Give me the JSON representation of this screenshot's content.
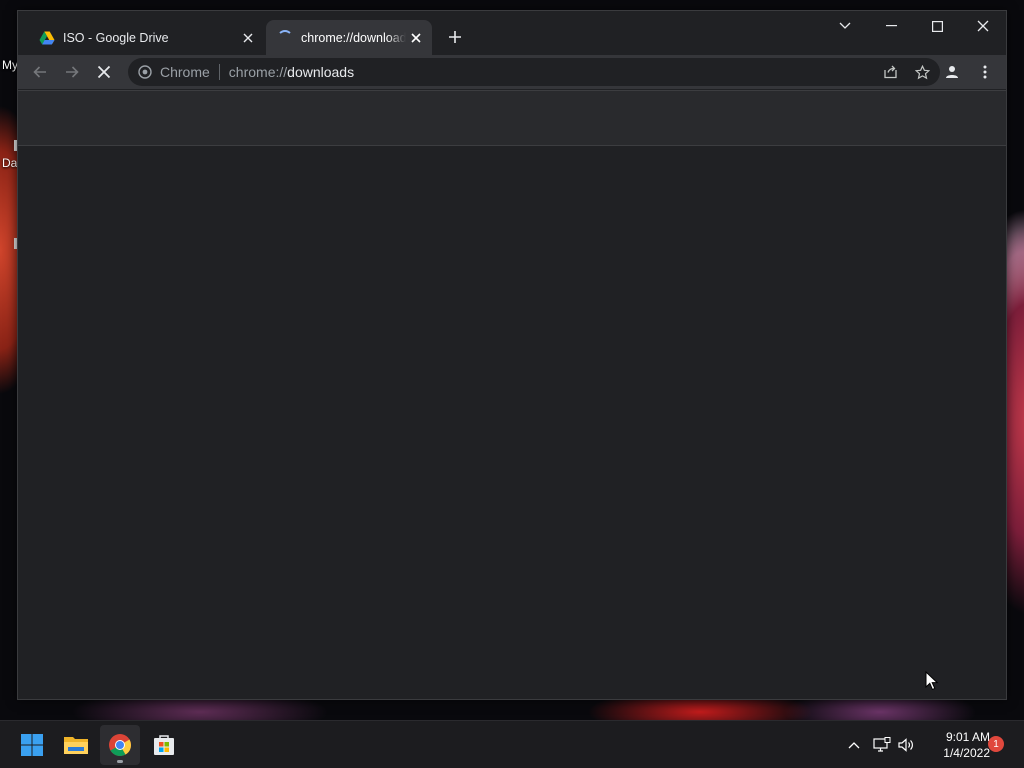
{
  "desktop": {
    "labels": [
      "My",
      "Da"
    ]
  },
  "browser": {
    "tabs": [
      {
        "title": "ISO - Google Drive",
        "favicon": "google-drive-icon",
        "active": false
      },
      {
        "title": "chrome://downloads",
        "favicon": "loading-spinner-icon",
        "active": true
      }
    ],
    "new_tab_icon": "plus-icon",
    "window_controls": [
      "tab-search-chevron-icon",
      "minimize-icon",
      "maximize-icon",
      "close-icon"
    ],
    "toolbar": {
      "back_icon": "arrow-left-icon",
      "forward_icon": "arrow-right-icon",
      "stop_icon": "close-x-icon"
    },
    "omnibox": {
      "chip": "Chrome",
      "url_scheme": "chrome://",
      "url_path": "downloads",
      "actions": [
        "share-icon",
        "bookmark-star-icon"
      ]
    },
    "profile_icon": "person-icon",
    "menu_icon": "vertical-dots-icon",
    "colors": {
      "frame": "#202124",
      "toolbar": "#35363a",
      "omnibox": "#202124",
      "page_header": "#292a2d",
      "spinner": "#8ab4f8"
    }
  },
  "taskbar": {
    "apps": [
      "windows-start-icon",
      "file-explorer-icon",
      "chrome-icon",
      "microsoft-store-icon"
    ],
    "tray": [
      "chevron-up-icon",
      "network-icon",
      "volume-icon"
    ],
    "time": "9:01 AM",
    "date": "1/4/2022",
    "notification_count": "1"
  }
}
